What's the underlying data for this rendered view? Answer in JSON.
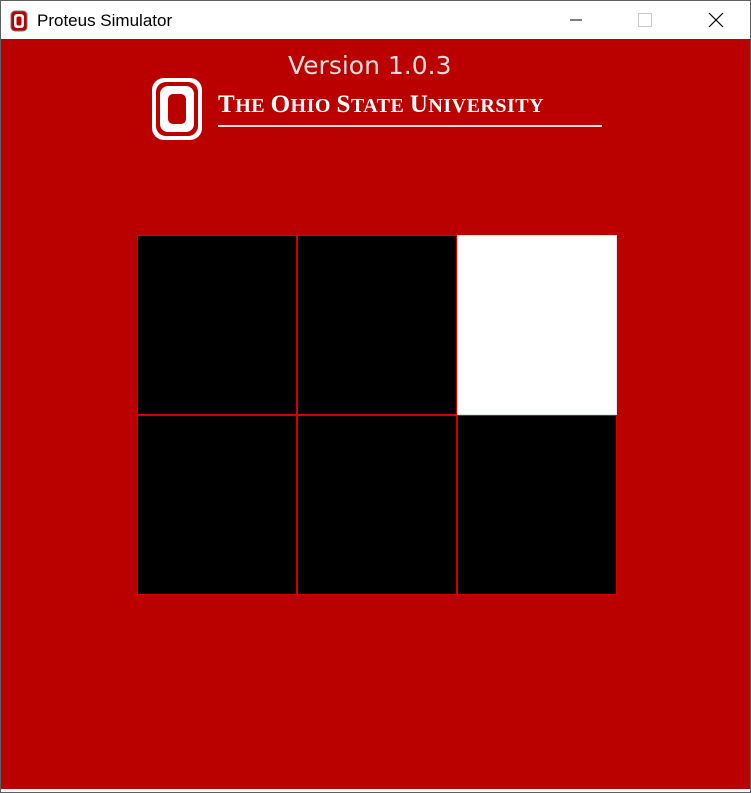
{
  "window": {
    "title": "Proteus Simulator",
    "app_icon": "ohio-state-block-o-icon",
    "controls": {
      "minimize_icon": "minimize-icon",
      "maximize_icon": "maximize-icon",
      "close_icon": "close-icon"
    }
  },
  "header": {
    "version": "Version 1.0.3",
    "logo_icon": "ohio-state-block-o-icon",
    "university_name": {
      "full": "The Ohio State University",
      "cap1": "T",
      "rest1": "HE ",
      "cap2": "O",
      "rest2": "HIO ",
      "cap3": "S",
      "rest3": "TATE ",
      "cap4": "U",
      "rest4": "NIVERSITY"
    }
  },
  "display": {
    "rows": 2,
    "cols": 3,
    "cells": [
      [
        "off",
        "off",
        "on"
      ],
      [
        "off",
        "off",
        "off"
      ]
    ]
  },
  "colors": {
    "background": "#bb0000",
    "cell_off": "#000000",
    "cell_on": "#ffffff",
    "grid_line": "#d40000"
  }
}
